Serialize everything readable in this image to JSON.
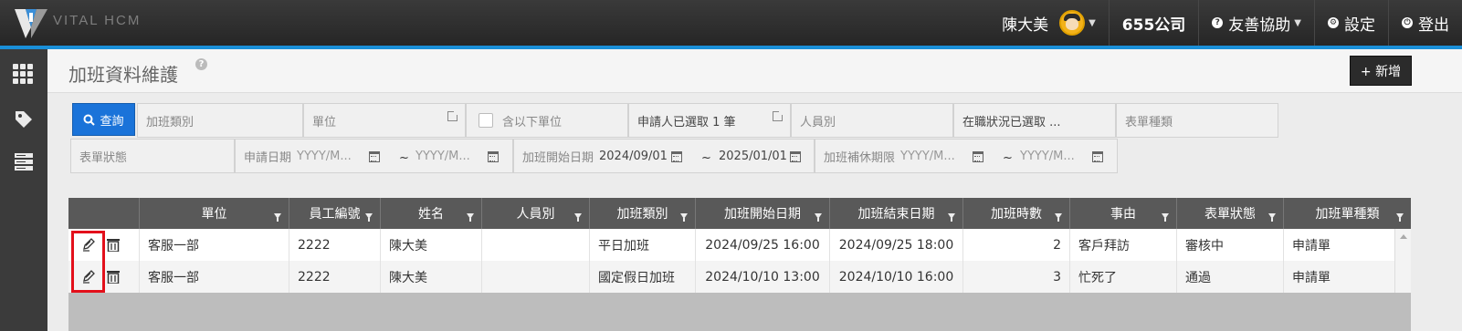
{
  "app": {
    "logo_text": "VITAL HCM"
  },
  "topbar": {
    "user_name": "陳大美",
    "company": "655公司",
    "help_menu": "友善協助",
    "settings": "設定",
    "logout": "登出"
  },
  "sidebar": {
    "icons": [
      "apps-grid-icon",
      "tag-icon",
      "server-icon"
    ]
  },
  "header": {
    "title": "加班資料維護",
    "add_button": "+ 新增"
  },
  "filters": {
    "query_button": "查詢",
    "overtime_type": "加班類別",
    "unit": "單位",
    "include_sub_units": "含以下單位",
    "applicant_selected": "申請人已選取 1 筆",
    "personnel_type": "人員別",
    "employment_status": "在職狀況已選取 ...",
    "form_category": "表單種類",
    "form_status": "表單狀態",
    "apply_date_label": "申請日期",
    "apply_date_from": "YYYY/M...",
    "apply_date_to": "YYYY/M...",
    "start_date_label": "加班開始日期",
    "start_date_from": "2024/09/01",
    "start_date_to": "2025/01/01",
    "comp_deadline_label": "加班補休期限",
    "comp_deadline_from": "YYYY/M...",
    "comp_deadline_to": "YYYY/M...",
    "tilde": "~"
  },
  "table": {
    "columns": [
      "單位",
      "員工編號",
      "姓名",
      "人員別",
      "加班類別",
      "加班開始日期",
      "加班結束日期",
      "加班時數",
      "事由",
      "表單狀態",
      "加班單種類"
    ],
    "rows": [
      {
        "unit": "客服一部",
        "emp_no": "2222",
        "name": "陳大美",
        "personnel_type": "",
        "ot_type": "平日加班",
        "start": "2024/09/25 16:00",
        "end": "2024/09/25 18:00",
        "hours": "2",
        "reason": "客戶拜訪",
        "status": "審核中",
        "form_type": "申請單"
      },
      {
        "unit": "客服一部",
        "emp_no": "2222",
        "name": "陳大美",
        "personnel_type": "",
        "ot_type": "國定假日加班",
        "start": "2024/10/10 13:00",
        "end": "2024/10/10 16:00",
        "hours": "3",
        "reason": "忙死了",
        "status": "通過",
        "form_type": "申請單"
      }
    ]
  },
  "colors": {
    "accent": "#1a8fd8",
    "query_button": "#1a73d9",
    "highlight": "#e3101b",
    "header_bg": "#595959"
  }
}
